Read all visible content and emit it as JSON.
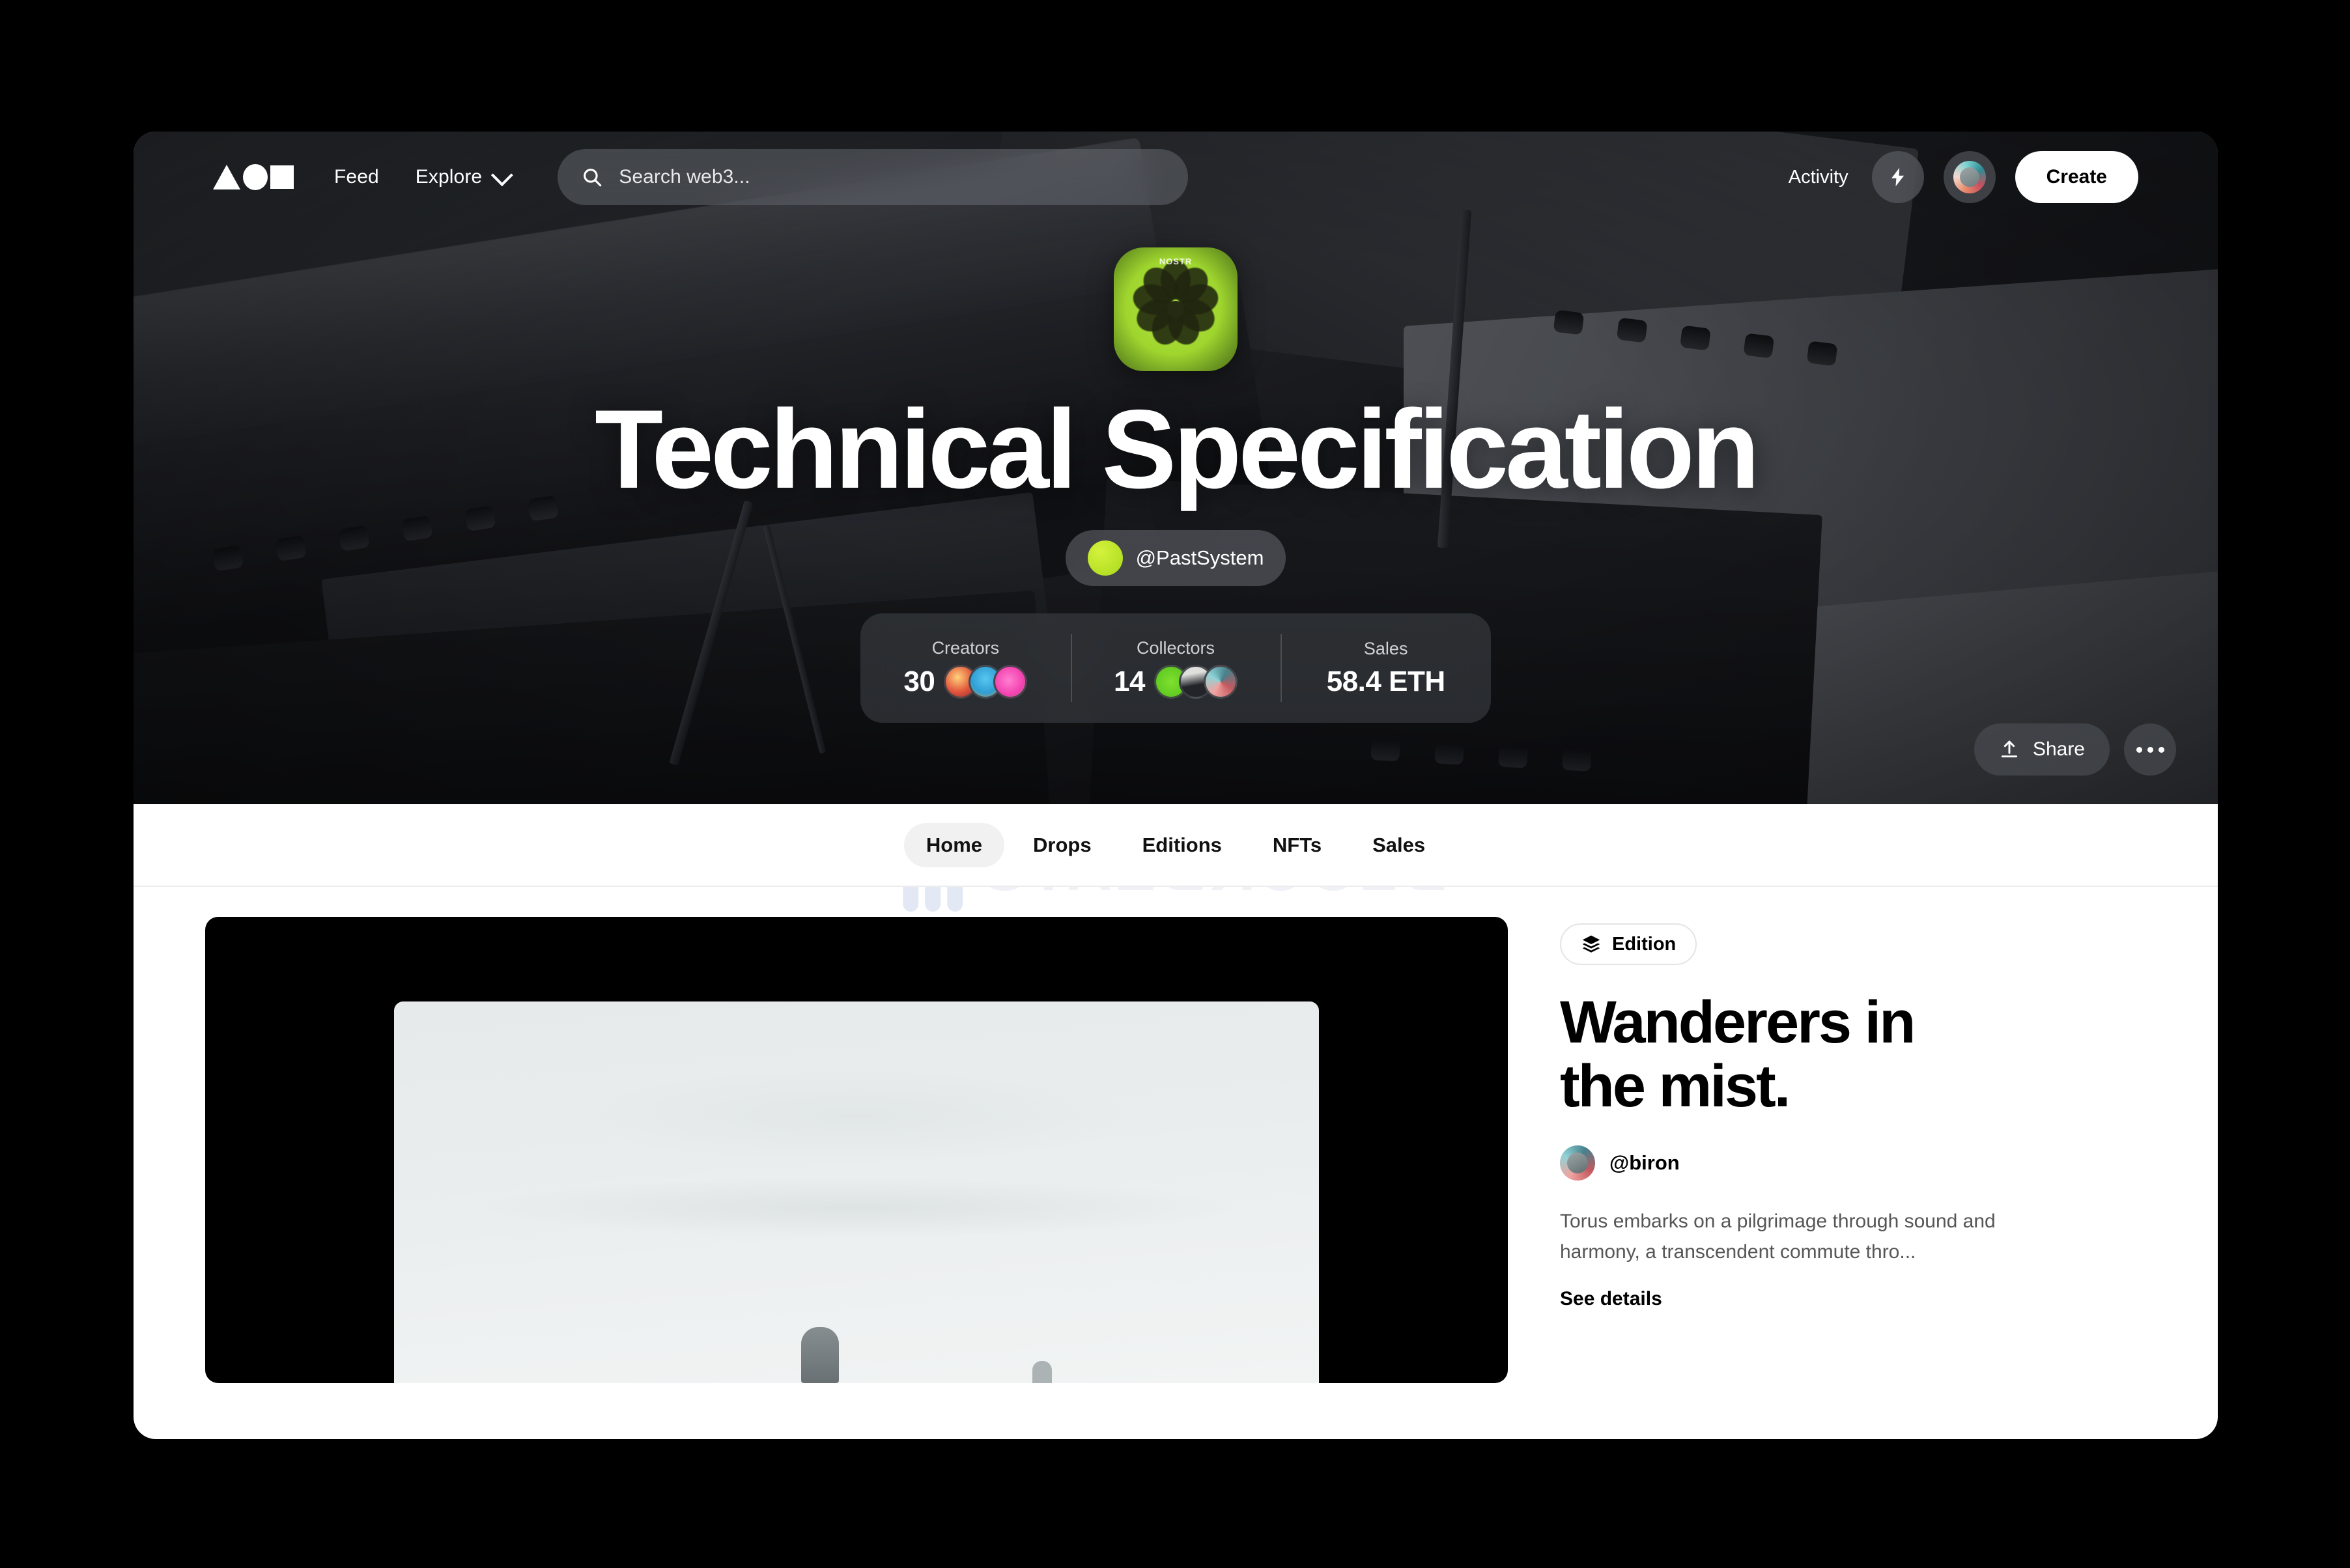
{
  "nav": {
    "logo_name": "foundation-logo",
    "feed_label": "Feed",
    "explore_label": "Explore",
    "search_placeholder": "Search web3...",
    "search_value": "",
    "activity_label": "Activity",
    "create_label": "Create"
  },
  "hero": {
    "profile_image_label": "NOSTR",
    "title": "Technical Specification",
    "username": "@PastSystem",
    "share_label": "Share",
    "stats": [
      {
        "label": "Creators",
        "value": "30",
        "avatars": [
          "a1",
          "a2",
          "a3"
        ]
      },
      {
        "label": "Collectors",
        "value": "14",
        "avatars": [
          "b1",
          "b2",
          "b3"
        ]
      },
      {
        "label": "Sales",
        "value": "58.4 ETH",
        "avatars": []
      }
    ]
  },
  "watermark": {
    "text": "BLOCKBEATS"
  },
  "tabs": [
    {
      "label": "Home",
      "active": true
    },
    {
      "label": "Drops",
      "active": false
    },
    {
      "label": "Editions",
      "active": false
    },
    {
      "label": "NFTs",
      "active": false
    },
    {
      "label": "Sales",
      "active": false
    }
  ],
  "detail": {
    "badge_label": "Edition",
    "title_line1": "Wanderers in",
    "title_line2": "the mist.",
    "creator": "@biron",
    "description": "Torus embarks on a pilgrimage through sound and harmony, a transcendent commute thro...",
    "see_details_label": "See details"
  },
  "colors": {
    "accent_green": "#a9d91c",
    "page_bg": "#ffffff",
    "shell_bg": "#000000",
    "hero_dark": "#26282c"
  }
}
